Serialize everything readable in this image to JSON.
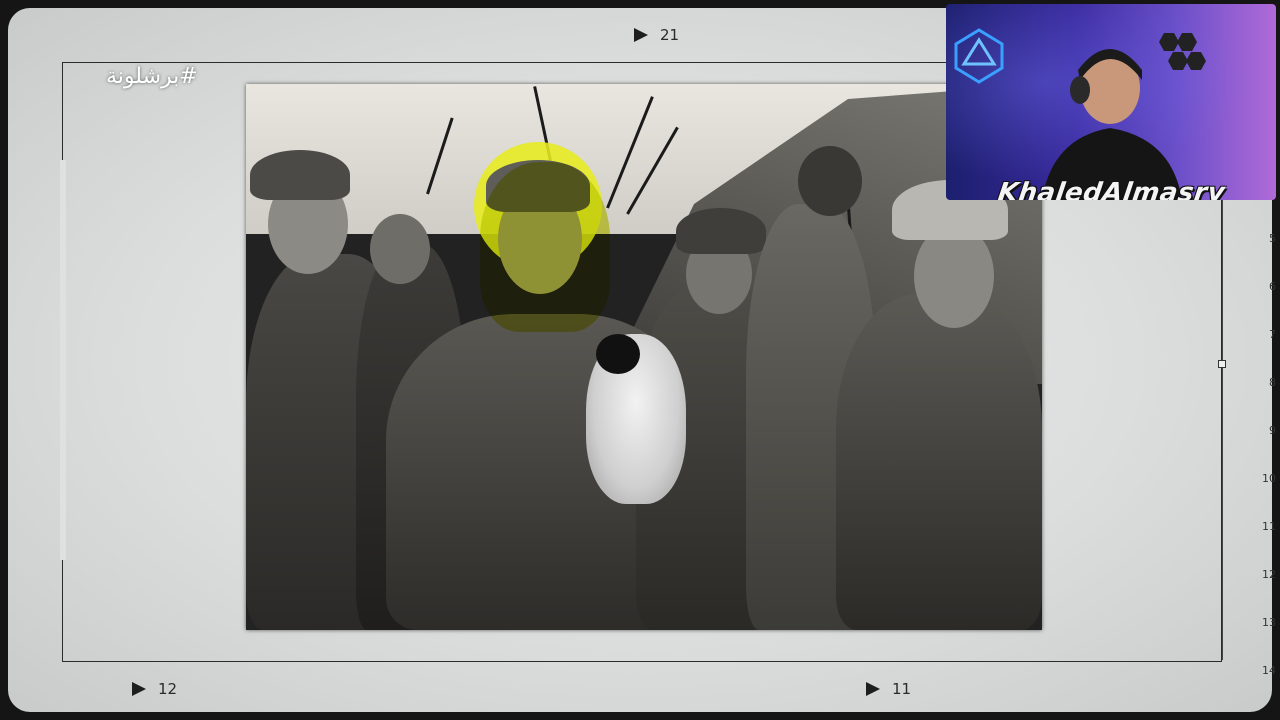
{
  "overlay": {
    "hashtag": "#برشلونة"
  },
  "markers": {
    "top": "21",
    "bottom_left": "12",
    "bottom_right": "11"
  },
  "ruler": [
    "5",
    "6",
    "7",
    "8",
    "9",
    "10",
    "11",
    "12",
    "13",
    "14"
  ],
  "webcam": {
    "streamer_name": "KhaledAlmasry"
  },
  "colors": {
    "highlight": "#e7ec1f",
    "frame_background": "#dcdede",
    "webcam_accent": "#3aa0ff"
  }
}
